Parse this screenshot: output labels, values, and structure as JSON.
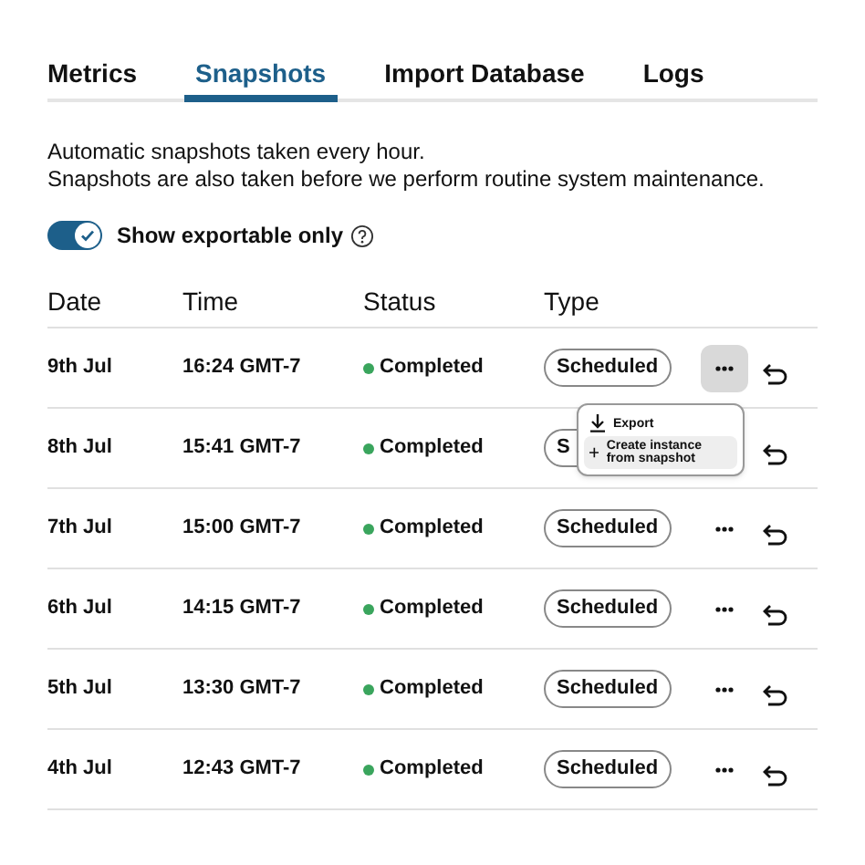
{
  "tabs": [
    {
      "label": "Metrics",
      "selected": false
    },
    {
      "label": "Snapshots",
      "selected": true
    },
    {
      "label": "Import Database",
      "selected": false
    },
    {
      "label": "Logs",
      "selected": false
    }
  ],
  "description": [
    "Automatic snapshots taken every hour.",
    "Snapshots are also taken before we perform routine system maintenance."
  ],
  "toggle": {
    "label": "Show exportable only",
    "on": true
  },
  "table": {
    "columns": [
      "Date",
      "Time",
      "Status",
      "Type"
    ],
    "rows": [
      {
        "date": "9th Jul",
        "time": "16:24 GMT-7",
        "status": "Completed",
        "type": "Scheduled",
        "menu_open": true
      },
      {
        "date": "8th Jul",
        "time": "15:41 GMT-7",
        "status": "Completed",
        "type": "S",
        "menu_open": false
      },
      {
        "date": "7th Jul",
        "time": "15:00 GMT-7",
        "status": "Completed",
        "type": "Scheduled",
        "menu_open": false
      },
      {
        "date": "6th Jul",
        "time": "14:15 GMT-7",
        "status": "Completed",
        "type": "Scheduled",
        "menu_open": false
      },
      {
        "date": "5th Jul",
        "time": "13:30 GMT-7",
        "status": "Completed",
        "type": "Scheduled",
        "menu_open": false
      },
      {
        "date": "4th Jul",
        "time": "12:43 GMT-7",
        "status": "Completed",
        "type": "Scheduled",
        "menu_open": false
      }
    ]
  },
  "menu": {
    "items": [
      {
        "kind": "export",
        "label": "Export",
        "selected": false
      },
      {
        "kind": "create",
        "label": "Create instance from snapshot",
        "selected": true
      }
    ]
  }
}
